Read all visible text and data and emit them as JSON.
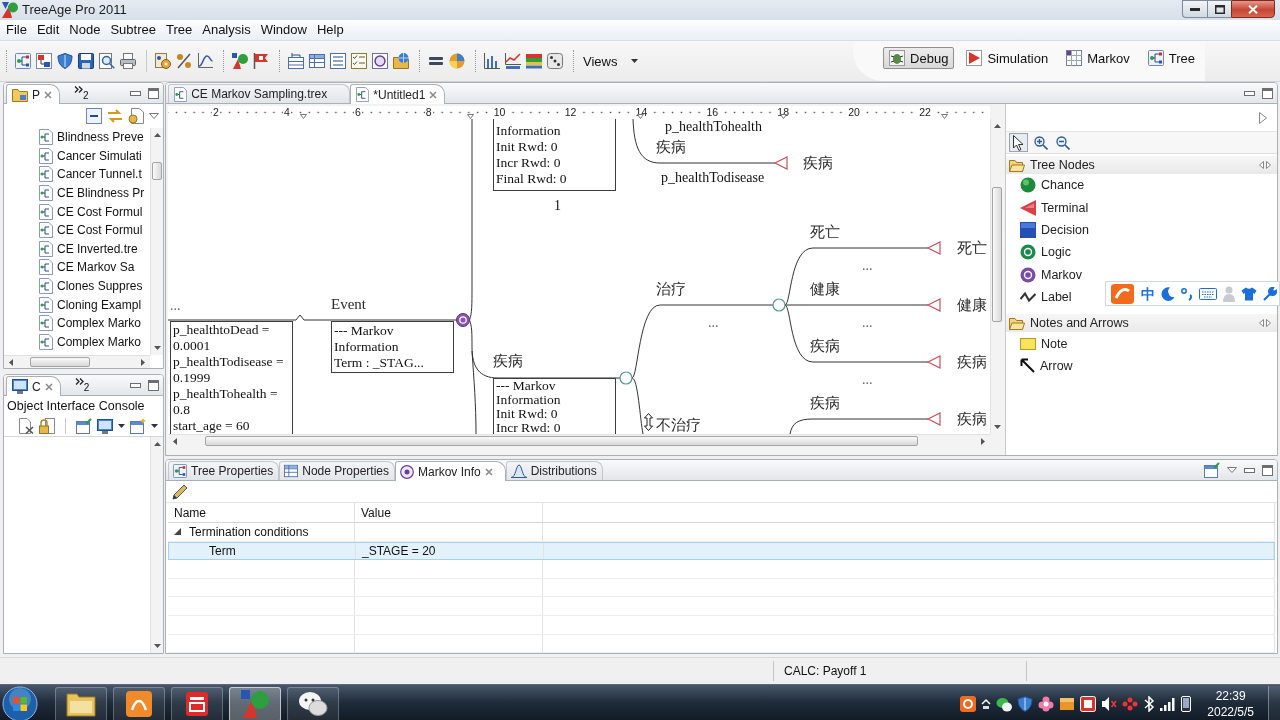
{
  "window": {
    "title": "TreeAge Pro 2011"
  },
  "menu": [
    "File",
    "Edit",
    "Node",
    "Subtree",
    "Tree",
    "Analysis",
    "Window",
    "Help"
  ],
  "toolbar": {
    "views": "Views",
    "perspectives": [
      {
        "label": "Debug",
        "kind": "debug",
        "selected": true
      },
      {
        "label": "Simulation",
        "kind": "simulation",
        "selected": false
      },
      {
        "label": "Markov",
        "kind": "markov",
        "selected": false
      },
      {
        "label": "Tree",
        "kind": "tree",
        "selected": false
      }
    ]
  },
  "explorer": {
    "tab": "P",
    "overflow": "2",
    "files": [
      "Blindness Preve",
      "Cancer Simulati",
      "Cancer Tunnel.t",
      "CE Blindness Pr",
      "CE Cost Formul",
      "CE Cost Formul",
      "CE Inverted.tre",
      "CE Markov Sa",
      "Clones Suppres",
      "Cloning Exampl",
      "Complex Marko",
      "Complex Marko"
    ]
  },
  "console": {
    "tab": "C",
    "overflow": "2",
    "title": "Object Interface Console"
  },
  "editor": {
    "tabs": [
      {
        "label": "CE Markov Sampling.trex",
        "selected": false
      },
      {
        "label": "*Untitled1",
        "selected": true
      }
    ],
    "ruler": [
      "2",
      "4",
      "6",
      "8",
      "10",
      "12",
      "14",
      "16",
      "18",
      "20",
      "22"
    ],
    "canvas": {
      "texts": [
        {
          "kind": "probability",
          "text": "p_healthTohealth"
        },
        {
          "kind": "branch",
          "text": "疾病"
        },
        {
          "kind": "terminal",
          "text": "疾病"
        },
        {
          "kind": "probability",
          "text": "p_healthTodisease"
        },
        {
          "kind": "value",
          "text": "1"
        },
        {
          "kind": "branch",
          "text": "死亡"
        },
        {
          "kind": "terminal",
          "text": "死亡"
        },
        {
          "kind": "ellipsis",
          "text": "..."
        },
        {
          "kind": "branch",
          "text": "治疗"
        },
        {
          "kind": "branch",
          "text": "健康"
        },
        {
          "kind": "ellipsis",
          "text": "..."
        },
        {
          "kind": "branch",
          "text": "Event"
        },
        {
          "kind": "terminal",
          "text": "健康"
        },
        {
          "kind": "ellipsis",
          "text": "..."
        },
        {
          "kind": "ellipsis",
          "text": "..."
        },
        {
          "kind": "branch",
          "text": "疾病"
        },
        {
          "kind": "branch",
          "text": "疾病"
        },
        {
          "kind": "terminal",
          "text": "疾病"
        },
        {
          "kind": "ellipsis",
          "text": "..."
        },
        {
          "kind": "branch",
          "text": "疾病"
        },
        {
          "kind": "terminal",
          "text": "疾病"
        },
        {
          "kind": "branch",
          "text": "不治疗"
        }
      ],
      "boxes": [
        {
          "lines": [
            "Information",
            "Init Rwd: 0",
            "Incr Rwd: 0",
            "Final Rwd: 0"
          ]
        },
        {
          "lines": [
            "p_healthtoDead =",
            "0.0001",
            "p_healthTodisease =",
            "0.1999",
            "p_healthTohealth =",
            "0.8",
            "start_age = 60"
          ]
        },
        {
          "lines": [
            "--- Markov",
            "Information",
            "Term : _STAG..."
          ]
        },
        {
          "lines": [
            "--- Markov",
            "Information",
            "Init Rwd: 0",
            "Incr Rwd: 0"
          ]
        }
      ],
      "nodes": [
        {
          "kind": "terminal"
        },
        {
          "kind": "terminal"
        },
        {
          "kind": "chance"
        },
        {
          "kind": "terminal"
        },
        {
          "kind": "markov"
        },
        {
          "kind": "terminal"
        },
        {
          "kind": "chance"
        },
        {
          "kind": "terminal"
        }
      ]
    }
  },
  "palette": {
    "tools": [
      {
        "kind": "select",
        "selected": true
      },
      {
        "kind": "zoom_in",
        "selected": false
      },
      {
        "kind": "zoom_out",
        "selected": false
      }
    ],
    "groups": [
      {
        "title": "Tree Nodes",
        "items": [
          {
            "label": "Chance",
            "kind": "chance"
          },
          {
            "label": "Terminal",
            "kind": "terminal"
          },
          {
            "label": "Decision",
            "kind": "decision"
          },
          {
            "label": "Logic",
            "kind": "logic"
          },
          {
            "label": "Markov",
            "kind": "markov"
          },
          {
            "label": "Label",
            "kind": "label"
          }
        ]
      },
      {
        "title": "Notes and Arrows",
        "items": [
          {
            "label": "Note",
            "kind": "note"
          },
          {
            "label": "Arrow",
            "kind": "arrow"
          }
        ]
      }
    ]
  },
  "ime_toolbar": {
    "mode": "中"
  },
  "properties": {
    "tabs": [
      {
        "label": "Tree Properties",
        "kind": "tree",
        "selected": false
      },
      {
        "label": "Node Properties",
        "kind": "node",
        "selected": false
      },
      {
        "label": "Markov Info",
        "kind": "markov",
        "selected": true
      },
      {
        "label": "Distributions",
        "kind": "distribution",
        "selected": false
      }
    ],
    "columns": [
      "Name",
      "Value"
    ],
    "rows": [
      {
        "name": "Termination conditions",
        "expanded": true,
        "selected": false,
        "children": [
          {
            "name": "Term",
            "value": "_STAGE = 20",
            "selected": true
          }
        ]
      }
    ]
  },
  "status_bar": {
    "text": "CALC: Payoff 1"
  },
  "taskbar": {
    "apps": [
      {
        "kind": "folder",
        "selected": false
      },
      {
        "kind": "pdf",
        "selected": false
      },
      {
        "kind": "dictionary",
        "selected": false
      },
      {
        "kind": "treeage",
        "selected": true
      },
      {
        "kind": "chat",
        "selected": false
      }
    ],
    "time": "22:39",
    "date": "2022/5/5"
  }
}
